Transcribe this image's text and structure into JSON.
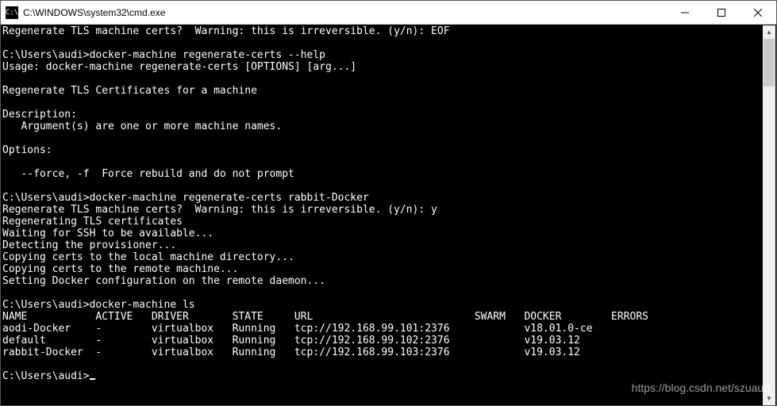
{
  "window": {
    "title": "C:\\WINDOWS\\system32\\cmd.exe",
    "icon_label": "C:\\"
  },
  "terminal": {
    "lines": [
      "Regenerate TLS machine certs?  Warning: this is irreversible. (y/n): EOF",
      "",
      "C:\\Users\\audi>docker-machine regenerate-certs --help",
      "Usage: docker-machine regenerate-certs [OPTIONS] [arg...]",
      "",
      "Regenerate TLS Certificates for a machine",
      "",
      "Description:",
      "   Argument(s) are one or more machine names.",
      "",
      "Options:",
      "",
      "   --force, -f  Force rebuild and do not prompt",
      "",
      "C:\\Users\\audi>docker-machine regenerate-certs rabbit-Docker",
      "Regenerate TLS machine certs?  Warning: this is irreversible. (y/n): y",
      "Regenerating TLS certificates",
      "Waiting for SSH to be available...",
      "Detecting the provisioner...",
      "Copying certs to the local machine directory...",
      "Copying certs to the remote machine...",
      "Setting Docker configuration on the remote daemon...",
      "",
      "C:\\Users\\audi>docker-machine ls"
    ],
    "table": {
      "headers": [
        "NAME",
        "ACTIVE",
        "DRIVER",
        "STATE",
        "URL",
        "SWARM",
        "DOCKER",
        "ERRORS"
      ],
      "rows": [
        {
          "name": "aodi-Docker",
          "active": "-",
          "driver": "virtualbox",
          "state": "Running",
          "url": "tcp://192.168.99.101:2376",
          "swarm": "",
          "docker": "v18.01.0-ce",
          "errors": ""
        },
        {
          "name": "default",
          "active": "-",
          "driver": "virtualbox",
          "state": "Running",
          "url": "tcp://192.168.99.102:2376",
          "swarm": "",
          "docker": "v19.03.12",
          "errors": ""
        },
        {
          "name": "rabbit-Docker",
          "active": "-",
          "driver": "virtualbox",
          "state": "Running",
          "url": "tcp://192.168.99.103:2376",
          "swarm": "",
          "docker": "v19.03.12",
          "errors": ""
        }
      ]
    },
    "prompt": "C:\\Users\\audi>"
  },
  "watermark": "https://blog.csdn.net/szuaud"
}
